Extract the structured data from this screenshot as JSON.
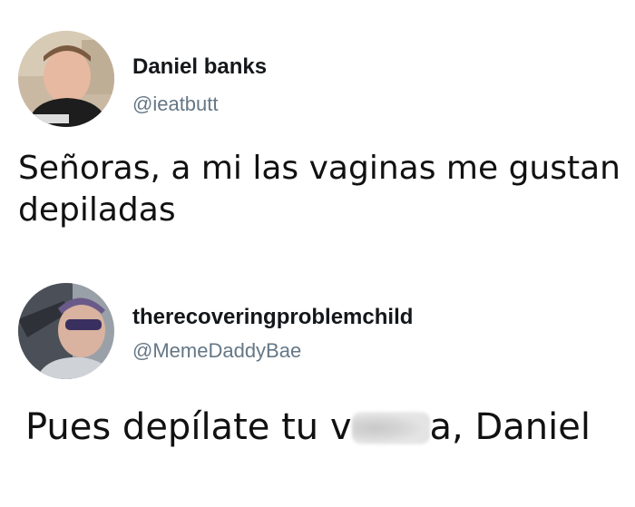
{
  "tweets": [
    {
      "author": {
        "name": "Daniel banks",
        "handle": "@ieatbutt"
      },
      "text": "Señoras, a mi las vaginas me gustan depiladas"
    },
    {
      "author": {
        "name": "therecoveringproblemchild",
        "handle": "@MemeDaddyBae"
      },
      "text_before": "Pues depílate tu v",
      "text_after": "a, Daniel"
    }
  ]
}
